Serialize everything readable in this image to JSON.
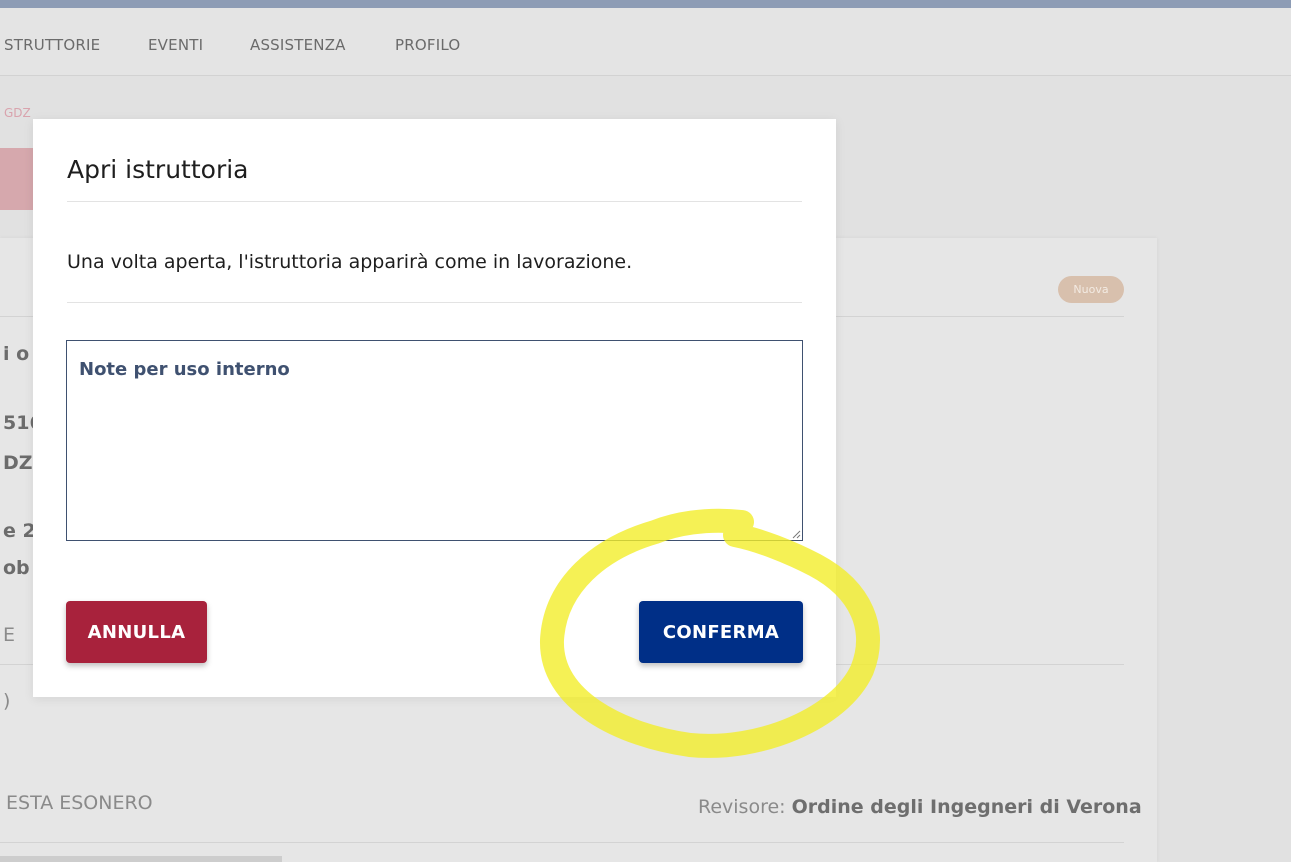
{
  "nav": {
    "items": [
      {
        "label": "STRUTTORIE"
      },
      {
        "label": "EVENTI"
      },
      {
        "label": "ASSISTENZA"
      },
      {
        "label": "PROFILO"
      }
    ]
  },
  "breadcrumb": "GDZ",
  "card": {
    "status_badge": "Nuova",
    "fragments": [
      "i o",
      "516",
      "DZ",
      "e 20",
      "ob",
      "E",
      ")"
    ],
    "bottom_left": "ESTA ESONERO",
    "reviewer_label": "Revisore:",
    "reviewer_value": "Ordine degli Ingegneri di Verona"
  },
  "modal": {
    "title": "Apri istruttoria",
    "message": "Una volta aperta, l'istruttoria apparirà come in lavorazione.",
    "notes_label": "Note per uso interno",
    "cancel_label": "ANNULLA",
    "confirm_label": "CONFERMA"
  },
  "colors": {
    "cancel": "#a8223c",
    "confirm": "#002f87",
    "highlight": "#f2ee2a"
  }
}
